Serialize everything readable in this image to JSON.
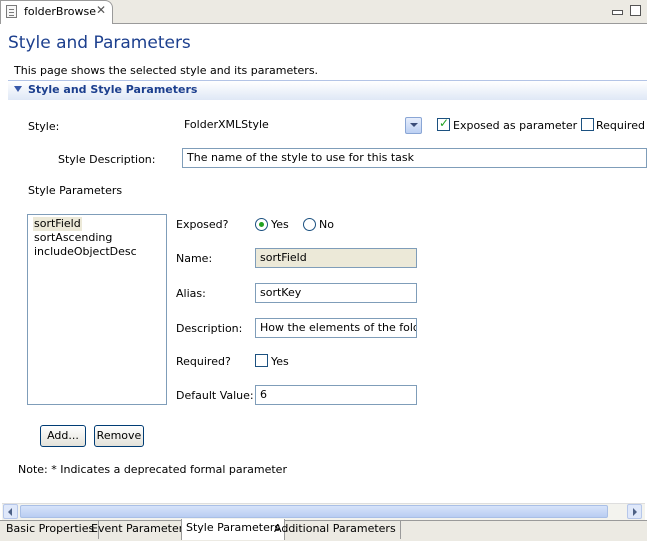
{
  "editor_tab": {
    "title": "folderBrowse",
    "close_glyph": "✕"
  },
  "form": {
    "title": "Style and Parameters",
    "description": "This page shows the selected style and its parameters."
  },
  "section": {
    "title": "Style and Style Parameters"
  },
  "style_row": {
    "label": "Style:",
    "value": "FolderXMLStyle",
    "exposed_label": "Exposed as parameter",
    "exposed_checked": true,
    "required_label": "Required",
    "required_checked": false
  },
  "style_description": {
    "label": "Style Description:",
    "value": "The name of the style to use for this task"
  },
  "style_parameters": {
    "label": "Style Parameters",
    "items": [
      {
        "label": "sortField",
        "selected": true
      },
      {
        "label": "sortAscending",
        "selected": false
      },
      {
        "label": "includeObjectDesc",
        "selected": false
      }
    ]
  },
  "details": {
    "exposed_label": "Exposed?",
    "yes_label": "Yes",
    "no_label": "No",
    "exposed_value": "Yes",
    "name_label": "Name:",
    "name_value": "sortField",
    "alias_label": "Alias:",
    "alias_value": "sortKey",
    "description_label": "Description:",
    "description_value": "How the elements of the folder",
    "required_label": "Required?",
    "required_yes_label": "Yes",
    "required_checked": false,
    "default_label": "Default Value:",
    "default_value": "6"
  },
  "buttons": {
    "add": "Add...",
    "remove": "Remove"
  },
  "note": "Note: * Indicates a deprecated formal parameter",
  "page_tabs": [
    {
      "label": "Basic Properties",
      "active": false
    },
    {
      "label": "Event Parameters",
      "active": false
    },
    {
      "label": "Style Parameters",
      "active": true
    },
    {
      "label": "Additional Parameters",
      "active": false
    }
  ],
  "colors": {
    "title": "#1c3f8e",
    "check": "#21a121",
    "field_border": "#7f9db9"
  },
  "icons": [
    "file-icon",
    "close-icon",
    "minimize-icon",
    "maximize-icon",
    "chevron-down-icon",
    "scroll-left-icon",
    "scroll-right-icon"
  ]
}
